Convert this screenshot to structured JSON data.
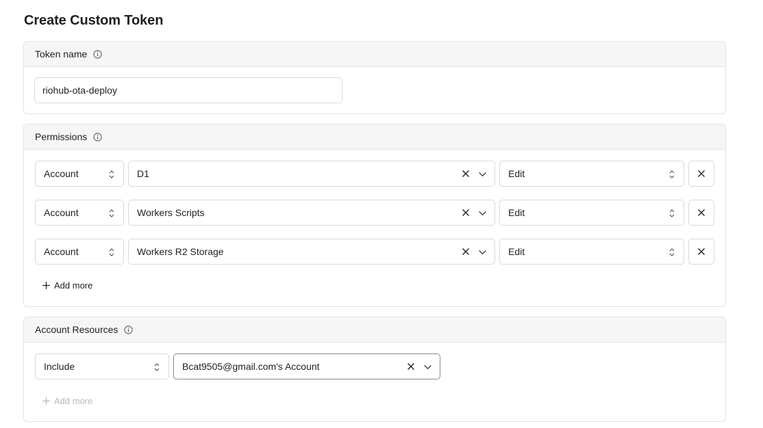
{
  "page": {
    "title": "Create Custom Token"
  },
  "token_name": {
    "title": "Token name",
    "value": "riohub-ota-deploy"
  },
  "permissions": {
    "title": "Permissions",
    "rows": [
      {
        "scope": "Account",
        "resource": "D1",
        "access": "Edit"
      },
      {
        "scope": "Account",
        "resource": "Workers Scripts",
        "access": "Edit"
      },
      {
        "scope": "Account",
        "resource": "Workers R2 Storage",
        "access": "Edit"
      }
    ],
    "add_more_label": "Add more"
  },
  "account_resources": {
    "title": "Account Resources",
    "mode": "Include",
    "account": "Bcat9505@gmail.com's Account",
    "add_more_label": "Add more"
  },
  "colors": {
    "border": "#e3e3e3",
    "header_bg": "#f6f6f6",
    "text": "#1f1f1f",
    "muted": "#b8b8b8"
  }
}
